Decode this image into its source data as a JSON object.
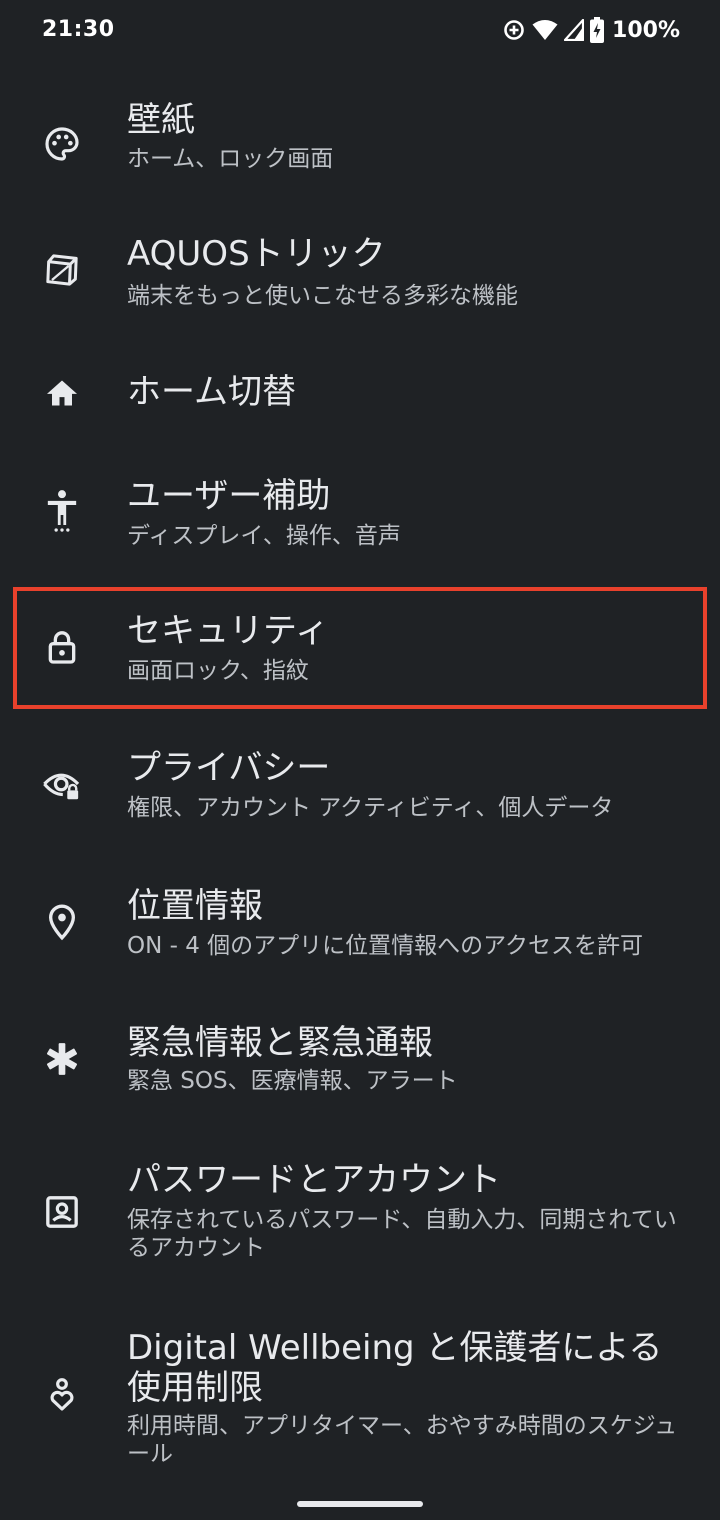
{
  "status_bar": {
    "time": "21:30",
    "battery": "100%",
    "icons": [
      "data-saver-icon",
      "wifi-icon",
      "signal-icon",
      "battery-charging-icon"
    ]
  },
  "settings": {
    "items": [
      {
        "title": "壁紙",
        "subtitle": "ホーム、ロック画面",
        "icon": "palette-icon"
      },
      {
        "title": "AQUOSトリック",
        "subtitle": "端末をもっと使いこなせる多彩な機能",
        "icon": "cube-icon"
      },
      {
        "title": "ホーム切替",
        "subtitle": "",
        "icon": "home-icon"
      },
      {
        "title": "ユーザー補助",
        "subtitle": "ディスプレイ、操作、音声",
        "icon": "accessibility-icon"
      },
      {
        "title": "セキュリティ",
        "subtitle": "画面ロック、指紋",
        "icon": "lock-icon"
      },
      {
        "title": "プライバシー",
        "subtitle": "権限、アカウント アクティビティ、個人データ",
        "icon": "privacy-eye-icon"
      },
      {
        "title": "位置情報",
        "subtitle": "ON - 4 個のアプリに位置情報へのアクセスを許可",
        "icon": "location-pin-icon"
      },
      {
        "title": "緊急情報と緊急通報",
        "subtitle": "緊急 SOS、医療情報、アラート",
        "icon": "asterisk-icon"
      },
      {
        "title": "パスワードとアカウント",
        "subtitle": "保存されているパスワード、自動入力、同期されているアカウント",
        "icon": "account-box-icon"
      },
      {
        "title": "Digital Wellbeing と保護者による使用制限",
        "subtitle": "利用時間、アプリタイマー、おやすみ時間のスケジュール",
        "icon": "wellbeing-icon"
      }
    ]
  },
  "colors": {
    "background": "#1f2225",
    "text_primary": "#e8eaed",
    "text_secondary": "#bdc1c6",
    "highlight": "#e8412c"
  }
}
